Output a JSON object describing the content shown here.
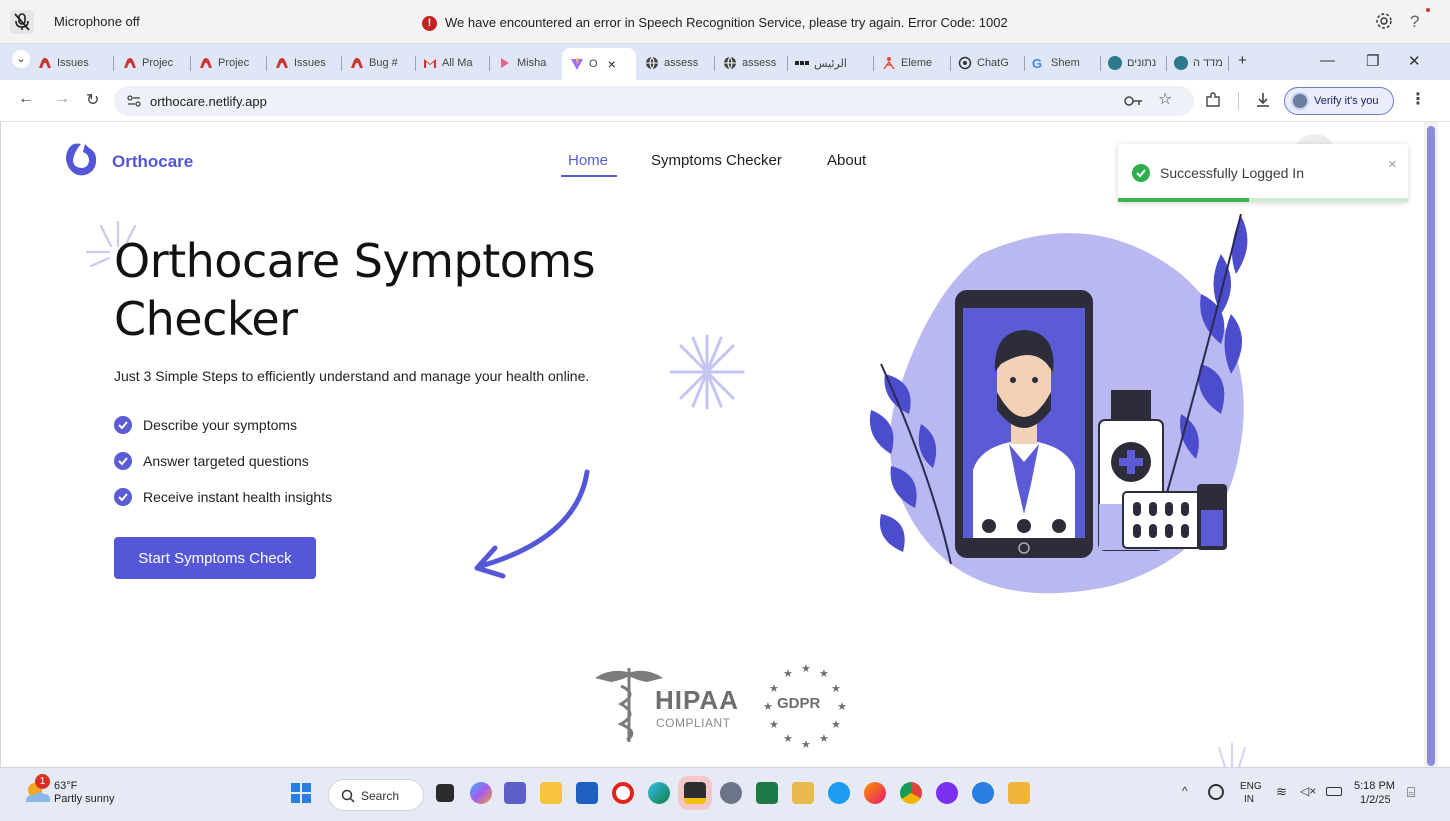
{
  "voice_bar": {
    "mic_status": "Microphone off",
    "error_message": "We have encountered an error in Speech Recognition Service, please try again. Error Code: 1002",
    "help": "?"
  },
  "tabs": [
    {
      "label": "Issues",
      "icon": "github-icon"
    },
    {
      "label": "Projec",
      "icon": "github-icon"
    },
    {
      "label": "Projec",
      "icon": "github-icon"
    },
    {
      "label": "Issues",
      "icon": "github-icon"
    },
    {
      "label": "Bug #",
      "icon": "github-icon"
    },
    {
      "label": "All Ma",
      "icon": "gmail-icon"
    },
    {
      "label": "Misha",
      "icon": "app-icon"
    },
    {
      "label": "O",
      "icon": "vite-icon",
      "active": true
    },
    {
      "label": "assess",
      "icon": "globe-icon"
    },
    {
      "label": "assess",
      "icon": "globe-icon"
    },
    {
      "label": "الرئيس",
      "icon": "dots-icon"
    },
    {
      "label": "Eleme",
      "icon": "element-icon"
    },
    {
      "label": "ChatG",
      "icon": "chatgpt-icon"
    },
    {
      "label": "Shem",
      "icon": "google-icon"
    },
    {
      "label": "נתונים",
      "icon": "app-icon"
    },
    {
      "label": "מדד ה",
      "icon": "app-icon"
    }
  ],
  "tabstrip_controls": {
    "new_tab": "+",
    "minimize": "—",
    "restore": "❐",
    "close": "✕",
    "tab_close": "×",
    "tab_list": "⌄"
  },
  "address_bar": {
    "url": "orthocare.netlify.app",
    "verify_label": "Verify it's you"
  },
  "site": {
    "brand": "Orthocare",
    "nav": [
      {
        "label": "Home",
        "active": true
      },
      {
        "label": "Symptoms Checker",
        "active": false
      },
      {
        "label": "About",
        "active": false
      }
    ],
    "hero_title_line1": "Orthocare Symptoms",
    "hero_title_line2": "Checker",
    "hero_subtitle": "Just 3 Simple Steps to efficiently understand and manage your health online.",
    "steps": [
      "Describe your symptoms",
      "Answer targeted questions",
      "Receive instant health insights"
    ],
    "cta_label": "Start Symptoms Check",
    "badge_hipaa": "HIPAA",
    "badge_hipaa_sub": "COMPLIANT",
    "badge_gdpr": "GDPR"
  },
  "toast": {
    "message": "Successfully Logged In",
    "close": "×",
    "progress": 0.45
  },
  "taskbar": {
    "weather_temp": "63°F",
    "weather_desc": "Partly sunny",
    "weather_badge": "1",
    "search_label": "Search",
    "lang": "ENG",
    "region": "IN",
    "time": "5:18 PM",
    "date": "1/2/25"
  },
  "colors": {
    "accent": "#5458d8",
    "success": "#3bb54a",
    "error": "#c5221f"
  }
}
